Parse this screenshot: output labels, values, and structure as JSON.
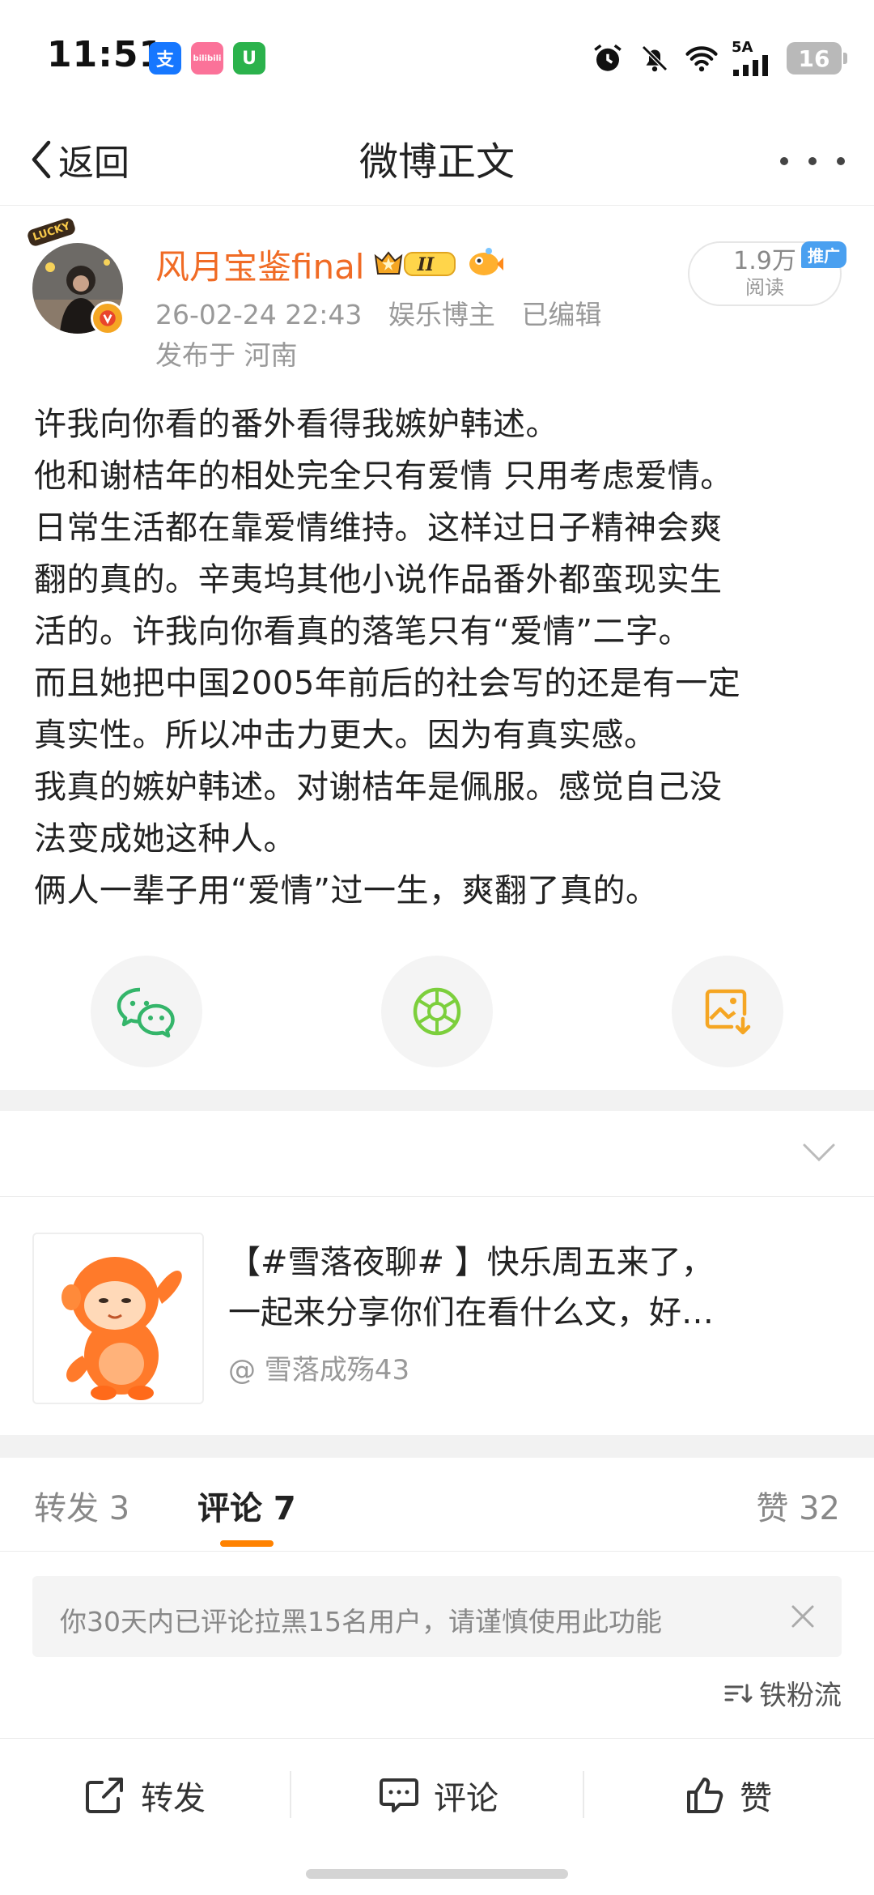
{
  "status_bar": {
    "time": "11:51",
    "apps": [
      {
        "icon": "alipay-icon",
        "glyph": "支",
        "color": "#1677ff"
      },
      {
        "icon": "bilibili-icon",
        "glyph": "bilibili",
        "color": "#fb7299"
      },
      {
        "icon": "green-app-icon",
        "glyph": "U",
        "color": "#2bb24c"
      }
    ],
    "network_label": "5A",
    "battery": "16"
  },
  "nav": {
    "back_label": "返回",
    "title": "微博正文"
  },
  "author": {
    "name": "风月宝鉴final",
    "avatar_tag": "LUCKY",
    "member_level": "II",
    "date": "26-02-24 22:43",
    "role": "娱乐博主",
    "edited": "已编辑",
    "location": "发布于 河南",
    "read_count": "1.9万",
    "read_label": "阅读",
    "promo_tag": "推广"
  },
  "post": {
    "lines": [
      "许我向你看的番外看得我嫉妒韩述。",
      "他和谢桔年的相处完全只有爱情 只用考虑爱情。",
      "日常生活都在靠爱情维持。这样过日子精神会爽",
      "翻的真的。辛夷坞其他小说作品番外都蛮现实生",
      "活的。许我向你看真的落笔只有“爱情”二字。",
      "而且她把中国2005年前后的社会写的还是有一定",
      "真实性。所以冲击力更大。因为有真实感。",
      "我真的嫉妒韩述。对谢桔年是佩服。感觉自己没",
      "法变成她这种人。",
      "俩人一辈子用“爱情”过一生，爽翻了真的。"
    ]
  },
  "share": {
    "wechat_icon": "wechat-icon",
    "moments_icon": "moments-icon",
    "save_image_icon": "save-image-icon"
  },
  "topic": {
    "line1": "【#雪落夜聊# 】快乐周五来了，",
    "line2": "一起来分享你们在看什么文，好…",
    "author": "@ 雪落成殇43"
  },
  "tabs": {
    "repost": "转发 3",
    "comment": "评论 7",
    "like": "赞 32"
  },
  "notice": {
    "text": "你30天内已评论拉黑15名用户，请谨慎使用此功能"
  },
  "sort": {
    "label": "铁粉流"
  },
  "bottom_bar": {
    "repost": "转发",
    "comment": "评论",
    "like": "赞"
  },
  "colors": {
    "accent": "#ff8200",
    "author_name": "#f06b25",
    "promo": "#4aa0f0",
    "wechat_green": "#34b56a",
    "moments_green": "#7ccf3c",
    "save_orange": "#f5a623"
  }
}
